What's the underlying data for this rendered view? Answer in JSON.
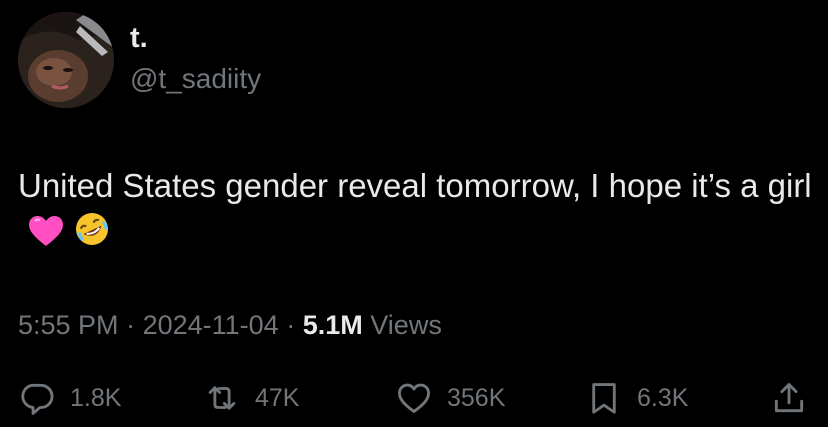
{
  "author": {
    "display_name": "t.",
    "handle": "@t_sadiity"
  },
  "tweet": {
    "text": "United States gender reveal tomorrow, I hope it’s a girl",
    "emojis": [
      "pink-heart-icon",
      "rolling-on-floor-laughing-icon"
    ]
  },
  "meta": {
    "time": "5:55 PM",
    "separator": "·",
    "date": "2024-11-04",
    "views_count": "5.1M",
    "views_label": "Views"
  },
  "actions": {
    "replies": "1.8K",
    "reposts": "47K",
    "likes": "356K",
    "bookmarks": "6.3K"
  },
  "colors": {
    "background": "#000000",
    "primary_text": "#e7e9ea",
    "secondary_text": "#71767b",
    "heart_emoji": "#ff4fc3",
    "laugh_emoji": "#f7c52b"
  }
}
